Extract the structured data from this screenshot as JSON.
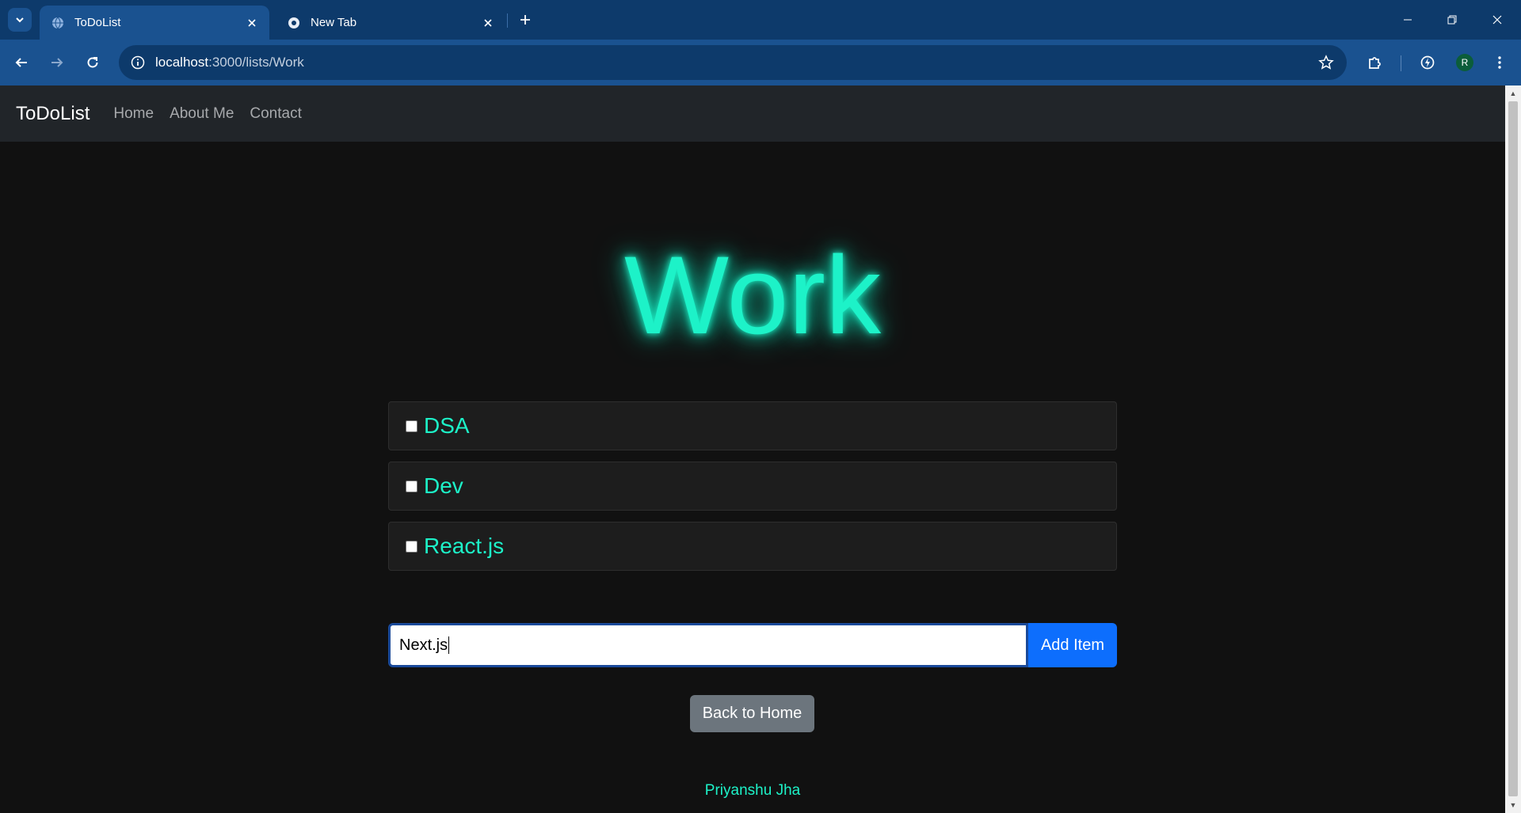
{
  "browser": {
    "tabs": [
      {
        "title": "ToDoList",
        "active": true
      },
      {
        "title": "New Tab",
        "active": false
      }
    ],
    "url_host": "localhost",
    "url_path": ":3000/lists/Work",
    "profile_initial": "R"
  },
  "navbar": {
    "brand": "ToDoList",
    "links": [
      "Home",
      "About Me",
      "Contact"
    ]
  },
  "list": {
    "title": "Work",
    "items": [
      {
        "text": "DSA",
        "checked": false
      },
      {
        "text": "Dev",
        "checked": false
      },
      {
        "text": "React.js",
        "checked": false
      }
    ]
  },
  "form": {
    "input_value": "Next.js",
    "add_label": "Add Item"
  },
  "back_label": "Back to Home",
  "footer": "Priyanshu Jha",
  "colors": {
    "accent": "#1df2c8",
    "primary_button": "#0d6efd",
    "secondary_button": "#6c757d",
    "navbar_bg": "#212529",
    "page_bg": "#111111"
  }
}
